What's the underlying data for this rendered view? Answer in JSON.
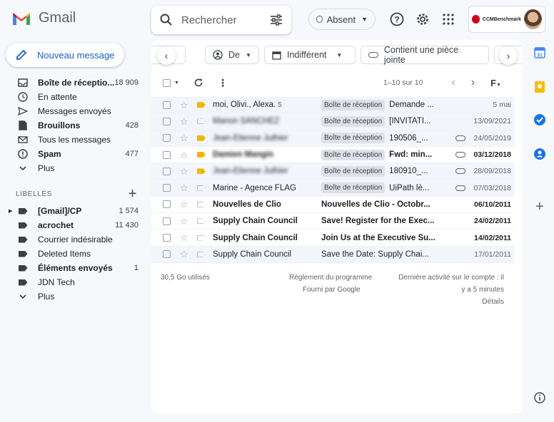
{
  "app": {
    "name": "Gmail"
  },
  "search": {
    "placeholder": "Rechercher"
  },
  "status": {
    "label": "Absent"
  },
  "account": {
    "brand": "CCMBenchmark"
  },
  "compose": {
    "label": "Nouveau message"
  },
  "sidebar": {
    "items": [
      {
        "label": "Boîte de réceptio...",
        "count": "18 909",
        "bold": true,
        "icon": "inbox-icon"
      },
      {
        "label": "En attente",
        "count": "",
        "bold": false,
        "icon": "clock-icon"
      },
      {
        "label": "Messages envoyés",
        "count": "",
        "bold": false,
        "icon": "send-icon"
      },
      {
        "label": "Brouillons",
        "count": "428",
        "bold": true,
        "icon": "draft-icon"
      },
      {
        "label": "Tous les messages",
        "count": "",
        "bold": false,
        "icon": "mail-icon"
      },
      {
        "label": "Spam",
        "count": "477",
        "bold": true,
        "icon": "spam-icon"
      },
      {
        "label": "Plus",
        "count": "",
        "bold": false,
        "icon": "chevron-down-icon"
      }
    ],
    "labels_title": "LIBELLÉS",
    "labels": [
      {
        "label": "[Gmail]/CP",
        "count": "1 574",
        "bold": true
      },
      {
        "label": "acrochet",
        "count": "11 430",
        "bold": true
      },
      {
        "label": "Courrier indésirable",
        "count": "",
        "bold": false
      },
      {
        "label": "Deleted Items",
        "count": "",
        "bold": false
      },
      {
        "label": "Éléments envoyés",
        "count": "1",
        "bold": true
      },
      {
        "label": "JDN Tech",
        "count": "",
        "bold": false
      },
      {
        "label": "Plus",
        "count": "",
        "bold": false
      }
    ]
  },
  "filters": {
    "from": "De",
    "date": "Indifférent",
    "attachment": "Contient une pièce jointe"
  },
  "pager": {
    "text": "1–10 sur 10"
  },
  "emails": [
    {
      "sender": "moi, Olivi., Alexa.",
      "thread_count": "5",
      "badge": "Boîte de réception",
      "subject": "Demande ...",
      "date": "5 mai",
      "unread": false,
      "important": true,
      "attachment": false,
      "blurred": false
    },
    {
      "sender": "Manon SANCHEZ",
      "thread_count": "",
      "badge": "Boîte de réception",
      "subject": "[INVITATI...",
      "date": "13/09/2021",
      "unread": false,
      "important": false,
      "attachment": false,
      "blurred": true
    },
    {
      "sender": "Jean-Etienne Juthier",
      "thread_count": "",
      "badge": "Boîte de réception",
      "subject": "190506_...",
      "date": "24/05/2019",
      "unread": false,
      "important": true,
      "attachment": true,
      "blurred": true
    },
    {
      "sender": "Damien Mangin",
      "thread_count": "",
      "badge": "Boîte de réception",
      "subject": "Fwd: min...",
      "date": "03/12/2018",
      "unread": true,
      "important": true,
      "attachment": true,
      "blurred": true
    },
    {
      "sender": "Jean-Etienne Juthier",
      "thread_count": "",
      "badge": "Boîte de réception",
      "subject": "180910_...",
      "date": "28/09/2018",
      "unread": false,
      "important": true,
      "attachment": true,
      "blurred": true
    },
    {
      "sender": "Marine - Agence FLAG",
      "thread_count": "",
      "badge": "Boîte de réception",
      "subject": "UiPath lè...",
      "date": "07/03/2018",
      "unread": false,
      "important": false,
      "attachment": true,
      "blurred": false
    },
    {
      "sender": "Nouvelles de Clio",
      "thread_count": "",
      "badge": "",
      "subject": "Nouvelles de Clio - Octobr...",
      "date": "06/10/2011",
      "unread": true,
      "important": false,
      "attachment": false,
      "blurred": false
    },
    {
      "sender": "Supply Chain Council",
      "thread_count": "",
      "badge": "",
      "subject": "Save! Register for the Exec...",
      "date": "24/02/2011",
      "unread": true,
      "important": false,
      "attachment": false,
      "blurred": false
    },
    {
      "sender": "Supply Chain Council",
      "thread_count": "",
      "badge": "",
      "subject": "Join Us at the Executive Su...",
      "date": "14/02/2011",
      "unread": true,
      "important": false,
      "attachment": false,
      "blurred": false
    },
    {
      "sender": "Supply Chain Council",
      "thread_count": "",
      "badge": "",
      "subject": "Save the Date: Supply Chai...",
      "date": "17/01/2011",
      "unread": false,
      "important": false,
      "attachment": false,
      "blurred": false
    }
  ],
  "footer": {
    "storage": "30,5 Go utilisés",
    "program": "Règlement du programme",
    "powered": "Fourni par Google",
    "activity_1": "Dernière activité sur le compte : il",
    "activity_2": "y a 5 minutes",
    "details": "Détails"
  }
}
